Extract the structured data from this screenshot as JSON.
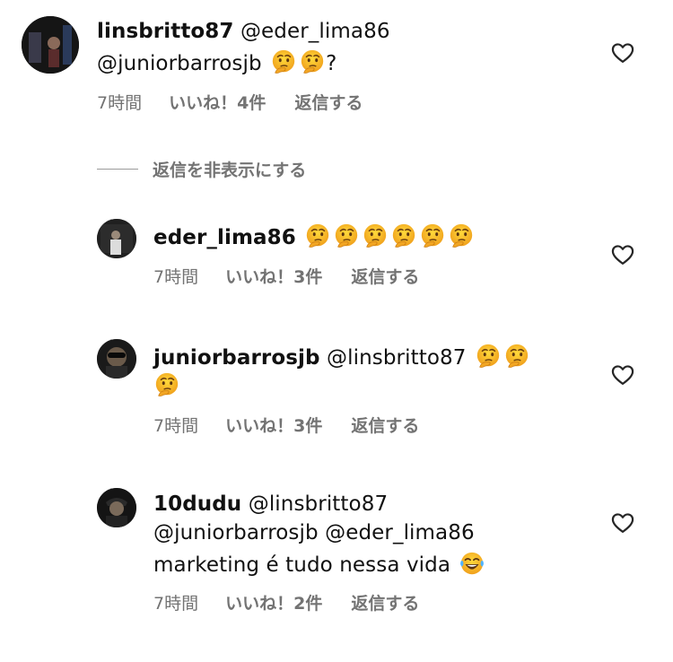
{
  "comments": [
    {
      "username": "linsbritto87",
      "lines": [
        "@eder_lima86",
        "@juniorbarrosjb"
      ],
      "line2_suffix": "?",
      "time": "7時間",
      "likes": "いいね！4件",
      "reply": "返信する",
      "emoji": "thinking-face-emoji"
    },
    {
      "username": "eder_lima86",
      "time": "7時間",
      "likes": "いいね！3件",
      "reply": "返信する",
      "emoji": "thinking-face-emoji"
    },
    {
      "username": "juniorbarrosjb",
      "lines": [
        "@linsbritto87"
      ],
      "time": "7時間",
      "likes": "いいね！3件",
      "reply": "返信する",
      "emoji": "thinking-face-emoji"
    },
    {
      "username": "10dudu",
      "lines": [
        "@linsbritto87",
        "@juniorbarrosjb @eder_lima86",
        "marketing é tudo nessa vida"
      ],
      "time": "7時間",
      "likes": "いいね！2件",
      "reply": "返信する",
      "emoji": "laughing-tears-emoji"
    }
  ],
  "hide_replies_label": "返信を非表示にする",
  "icons": {
    "like": "heart-outline-icon"
  },
  "colors": {
    "text": "#111111",
    "meta": "#737373",
    "emoji_face": "#f5b31b"
  }
}
